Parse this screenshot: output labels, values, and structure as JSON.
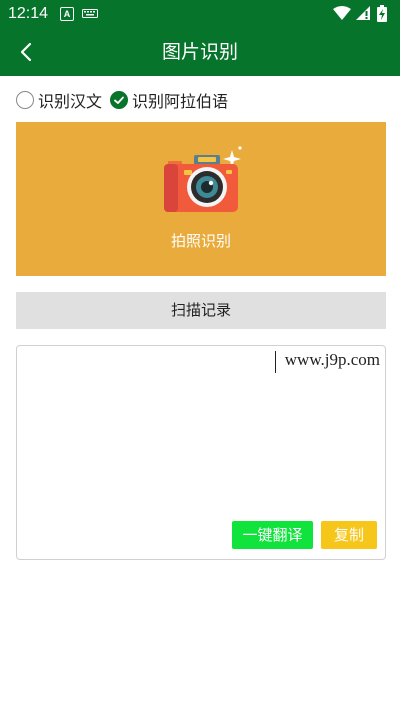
{
  "status_bar": {
    "time": "12:14",
    "a_icon_label": "A",
    "icons": [
      "a-icon",
      "keyboard-icon",
      "wifi-icon",
      "signal-icon",
      "battery-icon"
    ]
  },
  "app_bar": {
    "title": "图片识别",
    "back_icon": "chevron-left-icon",
    "color": "#07742b"
  },
  "language_options": [
    {
      "label": "识别汉文",
      "selected": false
    },
    {
      "label": "识别阿拉伯语",
      "selected": true
    }
  ],
  "camera_card": {
    "label": "拍照识别",
    "icon": "camera-icon",
    "color": "#e8ab3c"
  },
  "scan_history_button": {
    "label": "扫描记录"
  },
  "result_area": {
    "text": "www.j9p.com"
  },
  "actions": {
    "translate_label": "一键翻译",
    "copy_label": "复制",
    "translate_color": "#11e33d",
    "copy_color": "#f6c61b"
  }
}
